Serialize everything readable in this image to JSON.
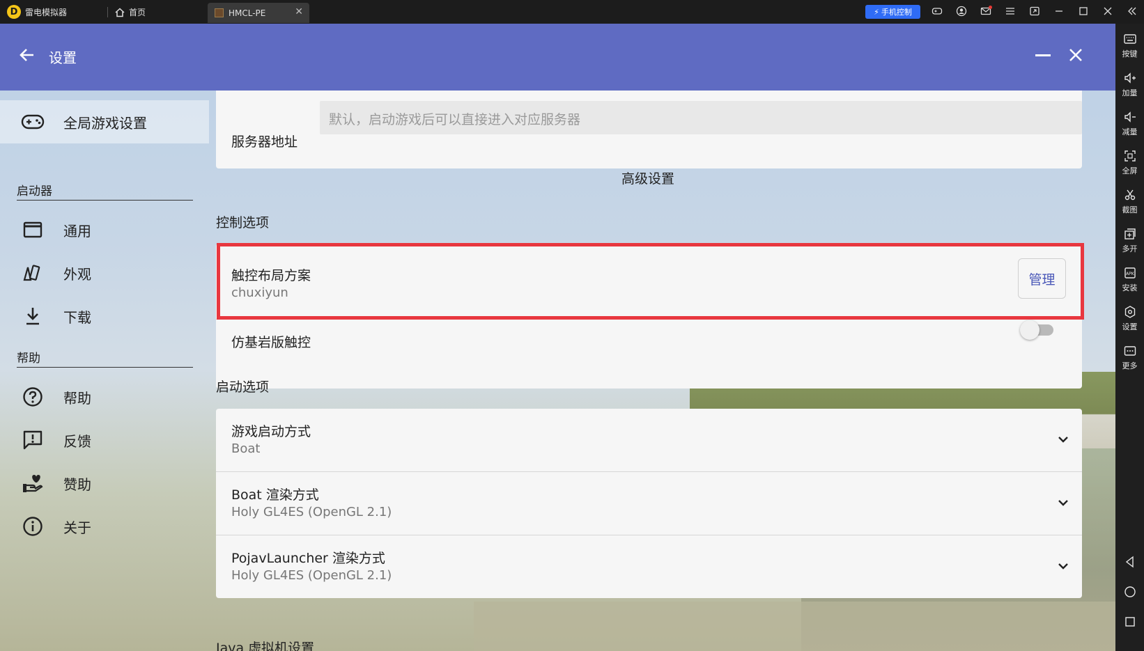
{
  "titlebar": {
    "app_name": "雷电模拟器",
    "home_tab": "首页",
    "active_tab": "HMCL-PE",
    "phone_control": "手机控制"
  },
  "right_toolbar": {
    "items": [
      {
        "label": "按键",
        "icon": "keyboard-icon"
      },
      {
        "label": "加量",
        "icon": "volume-up-icon"
      },
      {
        "label": "减量",
        "icon": "volume-down-icon"
      },
      {
        "label": "全屏",
        "icon": "fullscreen-icon"
      },
      {
        "label": "截图",
        "icon": "scissors-icon"
      },
      {
        "label": "多开",
        "icon": "multi-instance-icon"
      },
      {
        "label": "安装",
        "icon": "apk-icon"
      },
      {
        "label": "设置",
        "icon": "gear-icon"
      },
      {
        "label": "更多",
        "icon": "more-icon"
      }
    ]
  },
  "appbar": {
    "title": "设置"
  },
  "nav": {
    "global": "全局游戏设置",
    "section_launcher": "启动器",
    "launcher_items": [
      {
        "label": "通用",
        "icon": "window-icon"
      },
      {
        "label": "外观",
        "icon": "cards-icon"
      },
      {
        "label": "下载",
        "icon": "download-icon"
      }
    ],
    "section_help": "帮助",
    "help_items": [
      {
        "label": "帮助",
        "icon": "help-circle-icon"
      },
      {
        "label": "反馈",
        "icon": "feedback-icon"
      },
      {
        "label": "赞助",
        "icon": "donate-hand-heart-icon"
      },
      {
        "label": "关于",
        "icon": "info-icon"
      }
    ]
  },
  "main": {
    "server_label": "服务器地址",
    "server_placeholder": "默认，启动游戏后可以直接进入对应服务器",
    "advanced_settings": "高级设置",
    "control_section": "控制选项",
    "touch_layout_label": "触控布局方案",
    "touch_layout_value": "chuxiyun",
    "manage_button": "管理",
    "bedrock_touch_label": "仿基岩版触控",
    "bedrock_touch_enabled": false,
    "launch_section": "启动选项",
    "launch_mode_label": "游戏启动方式",
    "launch_mode_value": "Boat",
    "boat_render_label": "Boat 渲染方式",
    "boat_render_value": "Holy GL4ES (OpenGL 2.1)",
    "pojav_render_label": "PojavLauncher 渲染方式",
    "pojav_render_value": "Holy GL4ES (OpenGL 2.1)",
    "java_section": "Java 虚拟机设置"
  },
  "colors": {
    "appbar": "#5f6bc2",
    "accent": "#4a58b8",
    "highlight": "#e8373f",
    "phone_button": "#2f6cf6"
  }
}
